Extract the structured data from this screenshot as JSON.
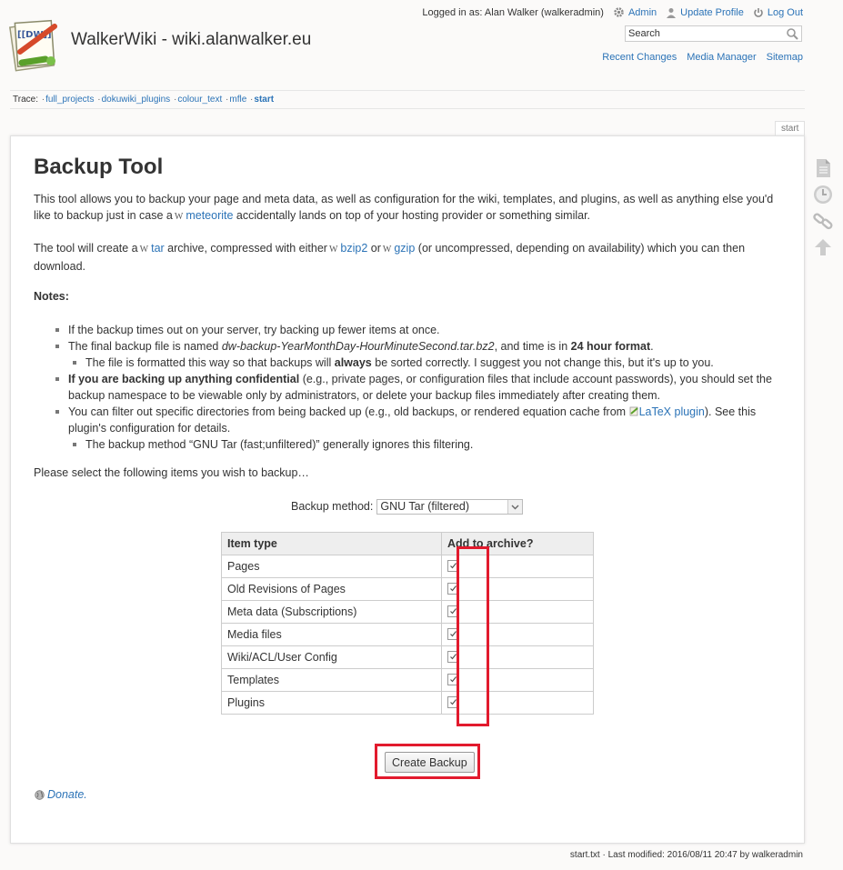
{
  "header": {
    "site_title": "WalkerWiki - wiki.alanwalker.eu",
    "logged_in_text": "Logged in as: Alan Walker (walkeradmin)",
    "admin_label": "Admin",
    "update_profile_label": "Update Profile",
    "logout_label": "Log Out",
    "search_placeholder": "Search",
    "site_tools": [
      "Recent Changes",
      "Media Manager",
      "Sitemap"
    ]
  },
  "breadcrumbs": {
    "label": "Trace:",
    "items": [
      "full_projects",
      "dokuwiki_plugins",
      "colour_text",
      "mfle",
      "start"
    ]
  },
  "page_tab": "start",
  "content": {
    "title": "Backup Tool",
    "intro_a": "This tool allows you to backup your page and meta data, as well as configuration for the wiki, templates, and plugins, as well as anything else you'd like to backup just in case a",
    "intro_link": "meteorite",
    "intro_b": "accidentally lands on top of your hosting provider or something similar.",
    "tool_a": "The tool will create a",
    "tool_link_tar": "tar",
    "tool_b": "archive, compressed with either",
    "tool_link_bzip2": "bzip2",
    "tool_or": "or",
    "tool_link_gzip": "gzip",
    "tool_c": "(or uncompressed, depending on availability) which you can then download.",
    "notes_heading": "Notes:",
    "note1": "If the backup times out on your server, try backing up fewer items at once.",
    "note2_a": "The final backup file is named",
    "note2_file": "dw-backup-YearMonthDay-HourMinuteSecond.tar.bz2",
    "note2_b": ", and time is in",
    "note2_bold": "24 hour format",
    "note2_c": ".",
    "note2_sub_a": "The file is formatted this way so that backups will",
    "note2_sub_bold": "always",
    "note2_sub_b": "be sorted correctly. I suggest you not change this, but it's up to you.",
    "note3_bold": "If you are backing up anything confidential",
    "note3_rest": "(e.g., private pages, or configuration files that include account passwords), you should set the backup namespace to be viewable only by administrators, or delete your backup files immediately after creating them.",
    "note4_a": "You can filter out specific directories from being backed up (e.g., old backups, or rendered equation cache from",
    "note4_link": "LaTeX plugin",
    "note4_b": "). See this plugin's configuration for details.",
    "note4_sub": "The backup method “GNU Tar (fast;unfiltered)” generally ignores this filtering.",
    "select_prompt": "Please select the following items you wish to backup…",
    "backup_method_label": "Backup method:",
    "backup_method_value": "GNU Tar (filtered)",
    "table_headers": [
      "Item type",
      "Add to archive?"
    ],
    "items": [
      {
        "label": "Pages",
        "checked": true
      },
      {
        "label": "Old Revisions of Pages",
        "checked": true
      },
      {
        "label": "Meta data (Subscriptions)",
        "checked": true
      },
      {
        "label": "Media files",
        "checked": true
      },
      {
        "label": "Wiki/ACL/User Config",
        "checked": true
      },
      {
        "label": "Templates",
        "checked": true
      },
      {
        "label": "Plugins",
        "checked": true
      }
    ],
    "create_button": "Create Backup",
    "donate": "Donate."
  },
  "footer": "start.txt · Last modified: 2016/08/11 20:47 by walkeradmin",
  "colors": {
    "link": "#2b73b7",
    "highlight": "#e21a2d",
    "text": "#333333"
  }
}
